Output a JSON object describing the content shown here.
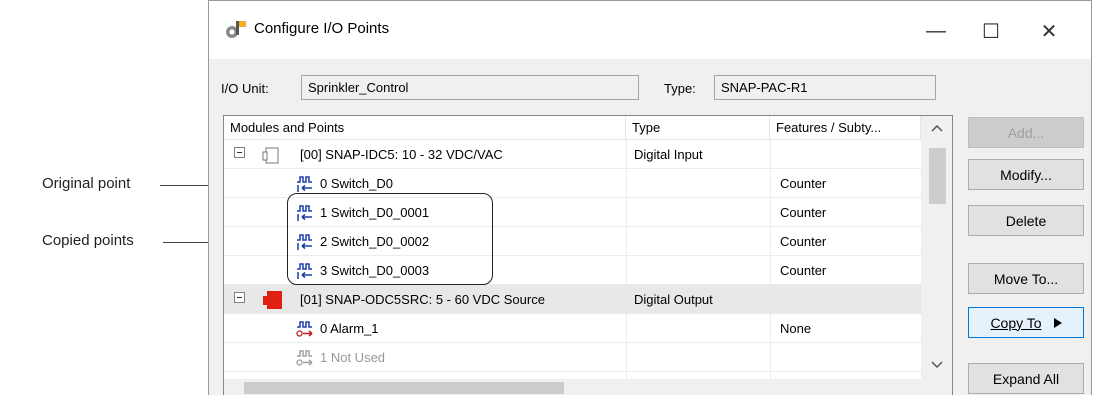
{
  "callouts": {
    "original": "Original point",
    "copied": "Copied points"
  },
  "window": {
    "title": "Configure I/O Points",
    "minimize": "—",
    "maximize": "☐",
    "close": "✕"
  },
  "io_unit": {
    "label": "I/O Unit:",
    "value": "Sprinkler_Control"
  },
  "type_field": {
    "label": "Type:",
    "value": "SNAP-PAC-R1"
  },
  "columns": [
    "Modules and Points",
    "Type",
    "Features / Subty..."
  ],
  "rows": [
    {
      "name": "[00] SNAP-IDC5: 10 - 32 VDC/VAC",
      "type": "Digital Input",
      "feature": ""
    },
    {
      "name": "0  Switch_D0",
      "type": "",
      "feature": "Counter"
    },
    {
      "name": "1  Switch_D0_0001",
      "type": "",
      "feature": "Counter"
    },
    {
      "name": "2  Switch_D0_0002",
      "type": "",
      "feature": "Counter"
    },
    {
      "name": "3  Switch_D0_0003",
      "type": "",
      "feature": "Counter"
    },
    {
      "name": "[01] SNAP-ODC5SRC: 5 - 60 VDC Source",
      "type": "Digital Output",
      "feature": ""
    },
    {
      "name": "0  Alarm_1",
      "type": "",
      "feature": "None"
    },
    {
      "name": "1  Not Used",
      "type": "",
      "feature": ""
    }
  ],
  "buttons": {
    "add": "Add...",
    "modify": "Modify...",
    "delete": "Delete",
    "move_to": "Move To...",
    "copy_to": "Copy To",
    "expand_all": "Expand All"
  },
  "colors": {
    "input_module": "#ffffff",
    "output_module": "#e02010",
    "point_icon": "#1a3fa8",
    "output_point_icon": "#c02020",
    "unused_point_icon": "#a0a0a0"
  }
}
